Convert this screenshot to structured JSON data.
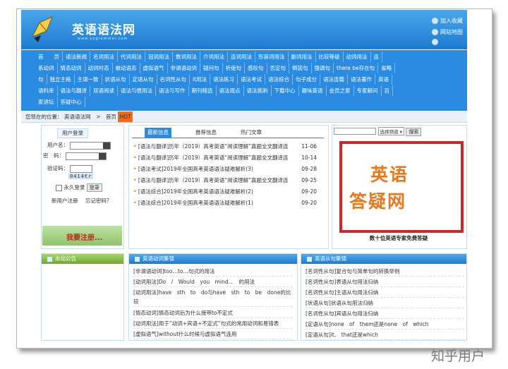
{
  "site": {
    "logo_text": "英语语法网",
    "logo_url": "www.yygrammar.com",
    "top_links": [
      "加入收藏",
      "网站地图"
    ]
  },
  "nav": {
    "rows": [
      [
        "首　　页",
        "语法新闻",
        "名词用法",
        "代词用法",
        "冠词用法",
        "数词用法",
        "介词用法",
        "连词用法",
        "形容词用法",
        "副词用法",
        "比较等级",
        "动词用法",
        "连"
      ],
      [
        "系动词",
        "情态动词",
        "动词时态",
        "被动语态",
        "虚拟语气",
        "非谓语动词",
        "疑问句",
        "祈使句",
        "感叹句",
        "否定句",
        "倒装句",
        "强调句",
        "there be存在句",
        "省略"
      ],
      [
        "句",
        "独立主格",
        "主谓一致",
        "状语从句",
        "定语从句",
        "名词性从句",
        "it用法",
        "语法练习",
        "语法考试",
        "语法综合",
        "句子成分",
        "语法连载",
        "语法著作",
        "英语"
      ],
      [
        "语料库",
        "语法与翻译",
        "双语阅读",
        "语法与惯用法",
        "语法与写作",
        "期刊精选",
        "语法观点",
        "语法挑刺",
        "下载中心",
        "趣味英语",
        "会员之家",
        "专家解问",
        "百"
      ],
      [
        "家讲坛",
        "答疑中心"
      ]
    ]
  },
  "breadcrumb": {
    "label": "您现在的位置：",
    "items": [
      "英语语法网",
      "首页"
    ],
    "separator": ">",
    "badge": "HOT"
  },
  "login": {
    "tab": "用户登录",
    "username_label": "用户名：",
    "password_label": "密　码：",
    "captcha_label": "验证码：",
    "captcha_value": "0414€r",
    "remember_label": "永久登录",
    "login_button": "登录",
    "register_link": "新用户注册",
    "forgot_link": "忘记密码？",
    "banner": "我要注册..."
  },
  "news": {
    "tabs": [
      "最新信息",
      "推荐信息",
      "热门文章"
    ],
    "items": [
      {
        "title": "[语法与翻译]历年（2019）高考英语“阅读理解”真题全文翻译连",
        "date": "11-06"
      },
      {
        "title": "[语法与翻译]历年（2019）高考英语“阅读理解”真题全文翻译连",
        "date": "10-14"
      },
      {
        "title": "[语法考试]2019年全国高考英语语法疑难解析(3)",
        "date": "09-28"
      },
      {
        "title": "[语法与翻译]历年（2019）高考英语“阅读理解”真题全文翻译连",
        "date": "09-25"
      },
      {
        "title": "[语法综合]2019年全国高考英语语法疑难解析(2)",
        "date": "09-20"
      },
      {
        "title": "[语法综合]2019年全国高考英语语法疑难解析(1)",
        "date": "09-20"
      }
    ]
  },
  "search": {
    "select_value": "选择频道",
    "button": "搜索"
  },
  "ad": {
    "line1": "英语",
    "line2": "答疑网",
    "caption": "数十位英语专家免费答疑"
  },
  "notice": {
    "title": "本站公告"
  },
  "verbs_panel": {
    "title": "英语动词集锦",
    "items": [
      "[非谓语动词]too…to…句式的用法",
      "[动词用法]Do　/　Would　you　mind…　的用法",
      "[动词用法]have　sth　to　do与have　sth　to　be　done的比较",
      "[情态动词]情态动词后为什么接带to不定式",
      "[动词用法]用于“动词+宾语+不定式”句式的常用动词和易错表",
      "[虚拟语气]without什么时候与虚拟语气连用"
    ]
  },
  "clauses_panel": {
    "title": "英语从句集锦",
    "items": [
      "[名词性从句]复合句与简单句的转换举例",
      "[名词性从句]表语从句用法归纳",
      "[名词性从句]主语从句用法归纳",
      "[状语从句]状语从句用法归纳",
      "[名词性从句]宾语从句用法归纳",
      "[定语从句]none　of　them还是none　of　which",
      "[定语从句]it,　that还是which"
    ]
  },
  "watermark": "知乎用户",
  "colors": {
    "banner": "#1b7bd3",
    "nav": "#2b8be0",
    "accent_orange": "#e8781c",
    "ad_border": "#c8292a"
  }
}
